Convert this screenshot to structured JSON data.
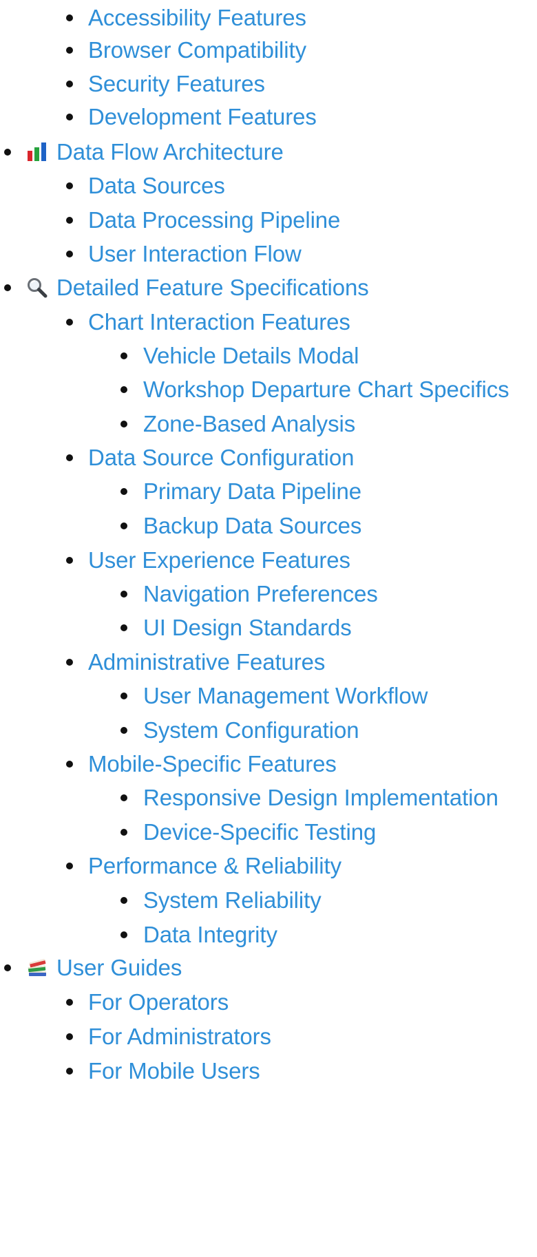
{
  "toc": {
    "items": [
      {
        "level": 1,
        "label": "Accessibility Features"
      },
      {
        "level": 1,
        "label": "Browser Compatibility"
      },
      {
        "level": 1,
        "label": "Security Features"
      },
      {
        "level": 1,
        "label": "Development Features"
      },
      {
        "level": 0,
        "label": "Data Flow Architecture",
        "icon": "bar-chart-icon"
      },
      {
        "level": 1,
        "label": "Data Sources"
      },
      {
        "level": 1,
        "label": "Data Processing Pipeline"
      },
      {
        "level": 1,
        "label": "User Interaction Flow"
      },
      {
        "level": 0,
        "label": "Detailed Feature Specifications",
        "icon": "magnifier-icon"
      },
      {
        "level": 1,
        "label": "Chart Interaction Features"
      },
      {
        "level": 2,
        "label": "Vehicle Details Modal"
      },
      {
        "level": 2,
        "label": "Workshop Departure Chart Specifics"
      },
      {
        "level": 2,
        "label": "Zone-Based Analysis"
      },
      {
        "level": 1,
        "label": "Data Source Configuration"
      },
      {
        "level": 2,
        "label": "Primary Data Pipeline"
      },
      {
        "level": 2,
        "label": "Backup Data Sources"
      },
      {
        "level": 1,
        "label": "User Experience Features"
      },
      {
        "level": 2,
        "label": "Navigation Preferences"
      },
      {
        "level": 2,
        "label": "UI Design Standards"
      },
      {
        "level": 1,
        "label": "Administrative Features"
      },
      {
        "level": 2,
        "label": "User Management Workflow"
      },
      {
        "level": 2,
        "label": "System Configuration"
      },
      {
        "level": 1,
        "label": "Mobile-Specific Features"
      },
      {
        "level": 2,
        "label": "Responsive Design Implementation"
      },
      {
        "level": 2,
        "label": "Device-Specific Testing"
      },
      {
        "level": 1,
        "label": "Performance & Reliability"
      },
      {
        "level": 2,
        "label": "System Reliability"
      },
      {
        "level": 2,
        "label": "Data Integrity"
      },
      {
        "level": 0,
        "label": "User Guides",
        "icon": "books-icon"
      },
      {
        "level": 1,
        "label": "For Operators"
      },
      {
        "level": 1,
        "label": "For Administrators"
      },
      {
        "level": 1,
        "label": "For Mobile Users"
      }
    ]
  },
  "colors": {
    "link": "#2f8fd8",
    "bullet": "#111111"
  }
}
